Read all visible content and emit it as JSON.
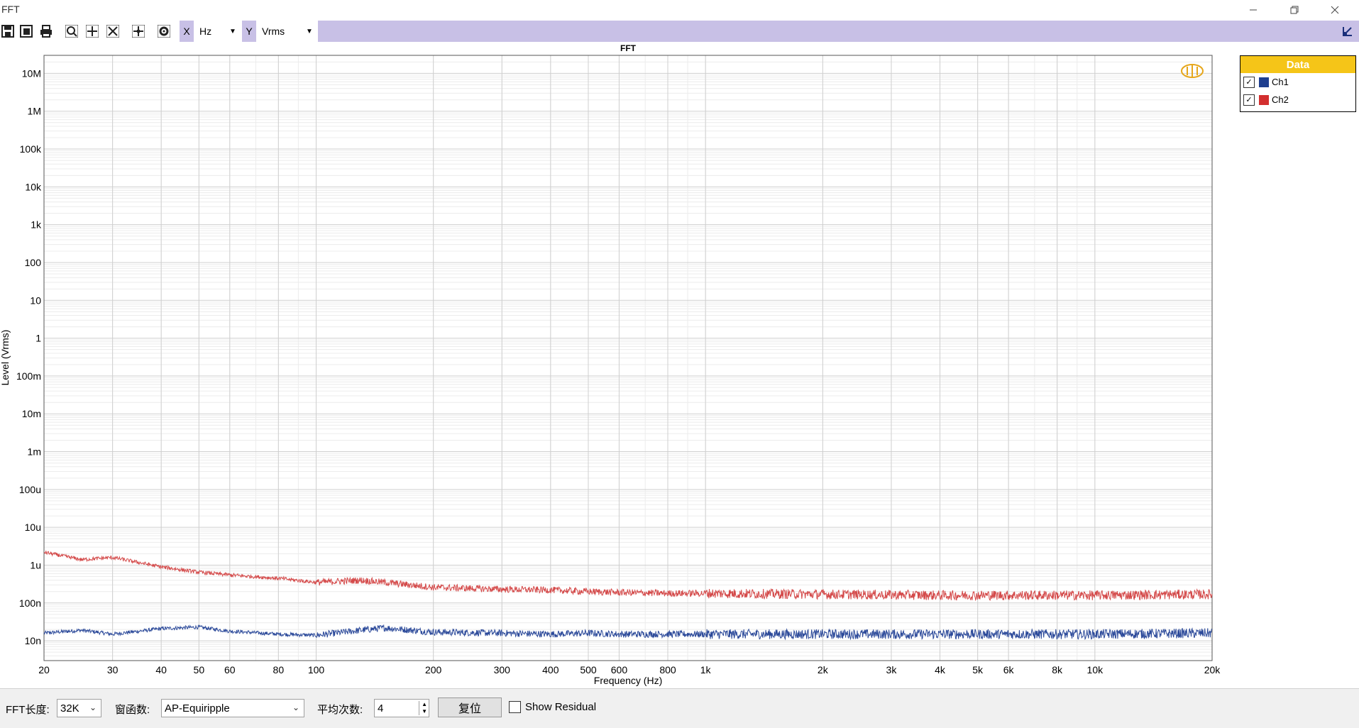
{
  "window": {
    "title": "FFT"
  },
  "toolbar": {
    "x_axis_letter": "X",
    "x_unit": "Hz",
    "y_axis_letter": "Y",
    "y_unit": "Vrms",
    "icons": [
      "save-icon",
      "export-icon",
      "print-icon",
      "zoom-icon",
      "pan-icon",
      "fit-icon",
      "cursor-icon",
      "settings-icon"
    ]
  },
  "legend": {
    "header": "Data",
    "items": [
      {
        "label": "Ch1",
        "color": "#1f3f8f",
        "checked": true
      },
      {
        "label": "Ch2",
        "color": "#d32f2f",
        "checked": true
      }
    ]
  },
  "chart_data": {
    "type": "line",
    "title": "FFT",
    "xlabel": "Frequency (Hz)",
    "ylabel": "Level (Vrms)",
    "x_scale": "log",
    "y_scale": "log",
    "xlim": [
      20,
      20000
    ],
    "ylim": [
      3e-09,
      30000000.0
    ],
    "x_ticks": [
      20,
      30,
      40,
      50,
      60,
      80,
      100,
      200,
      300,
      400,
      500,
      600,
      800,
      1000,
      2000,
      3000,
      4000,
      5000,
      6000,
      8000,
      10000,
      20000
    ],
    "x_tick_labels": [
      "20",
      "30",
      "40",
      "50",
      "60",
      "80",
      "100",
      "200",
      "300",
      "400",
      "500",
      "600",
      "800",
      "1k",
      "2k",
      "3k",
      "4k",
      "5k",
      "6k",
      "8k",
      "10k",
      "20k"
    ],
    "y_ticks": [
      1e-08,
      1e-07,
      1e-06,
      1e-05,
      0.0001,
      0.001,
      0.01,
      0.1,
      1,
      10,
      100,
      1000,
      10000,
      100000,
      1000000,
      10000000
    ],
    "y_tick_labels": [
      "10n",
      "100n",
      "1u",
      "10u",
      "100u",
      "1m",
      "10m",
      "100m",
      "1",
      "10",
      "100",
      "1k",
      "10k",
      "100k",
      "1M",
      "10M"
    ],
    "grid": true,
    "legend_position": "outside-top-right",
    "series": [
      {
        "name": "Ch1",
        "color": "#2c4a9a",
        "x": [
          20,
          25,
          30,
          40,
          50,
          60,
          80,
          100,
          130,
          150,
          200,
          300,
          400,
          500,
          600,
          800,
          1000,
          2000,
          4000,
          10000,
          20000
        ],
        "y": [
          1.6e-08,
          1.9e-08,
          1.5e-08,
          2.1e-08,
          2.3e-08,
          1.8e-08,
          1.5e-08,
          1.4e-08,
          1.9e-08,
          2.2e-08,
          1.7e-08,
          1.6e-08,
          1.5e-08,
          1.6e-08,
          1.5e-08,
          1.5e-08,
          1.5e-08,
          1.5e-08,
          1.5e-08,
          1.5e-08,
          1.6e-08
        ]
      },
      {
        "name": "Ch2",
        "color": "#d44a4a",
        "x": [
          20,
          25,
          30,
          40,
          50,
          60,
          80,
          100,
          130,
          150,
          200,
          300,
          400,
          500,
          600,
          800,
          1000,
          2000,
          4000,
          10000,
          20000
        ],
        "y": [
          2.2e-06,
          1.4e-06,
          1.6e-06,
          9e-07,
          6.5e-07,
          5.5e-07,
          4.5e-07,
          3.5e-07,
          4e-07,
          3.5e-07,
          2.6e-07,
          2.3e-07,
          2.2e-07,
          2e-07,
          1.9e-07,
          1.8e-07,
          1.8e-07,
          1.7e-07,
          1.6e-07,
          1.6e-07,
          1.7e-07
        ]
      }
    ]
  },
  "bottom": {
    "fft_len_label": "FFT长度:",
    "fft_len_value": "32K",
    "window_label": "窗函数:",
    "window_value": "AP-Equiripple",
    "avg_label": "平均次数:",
    "avg_value": "4",
    "reset_label": "复位",
    "residual_label": "Show Residual"
  }
}
